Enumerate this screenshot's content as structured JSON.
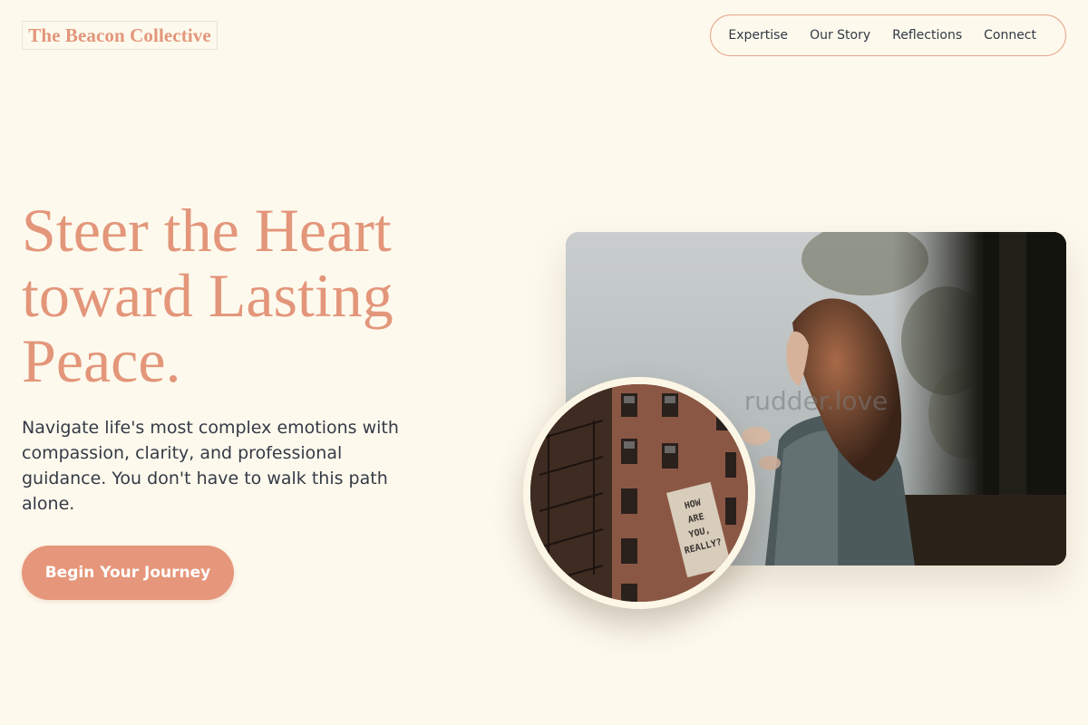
{
  "brand": {
    "name": "The Beacon Collective"
  },
  "nav": {
    "items": [
      "Expertise",
      "Our Story",
      "Reflections",
      "Connect"
    ]
  },
  "hero": {
    "headline_lines": [
      "Steer the Heart",
      "toward Lasting",
      "Peace."
    ],
    "subtext": "Navigate life's most complex emotions with compassion, clarity, and professional guidance. You don't have to walk this path alone.",
    "cta_label": "Begin Your Journey"
  },
  "images": {
    "main_watermark": "rudder.love",
    "circle_sign_lines": [
      "HOW",
      "ARE",
      "YOU,",
      "REALLY?"
    ]
  },
  "colors": {
    "background": "#fdf9ed",
    "accent": "#e3967a",
    "text": "#343a46"
  }
}
